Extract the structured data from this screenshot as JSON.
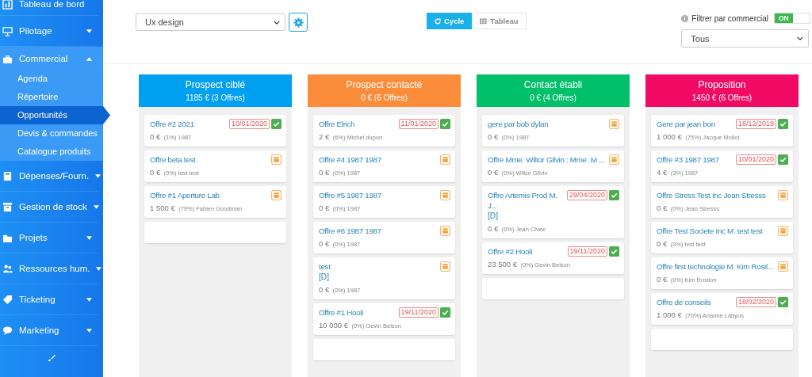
{
  "sidebar": {
    "items": [
      {
        "label": "Tableau de bord",
        "expanded": false,
        "has_caret": false
      },
      {
        "label": "Pilotage",
        "expanded": false,
        "has_caret": true
      },
      {
        "label": "Commercial",
        "expanded": true,
        "has_caret": true,
        "children": [
          {
            "label": "Agenda",
            "selected": false
          },
          {
            "label": "Répertoire",
            "selected": false
          },
          {
            "label": "Opportunités",
            "selected": true
          },
          {
            "label": "Devis & commandes",
            "selected": false
          },
          {
            "label": "Catalogue produits",
            "selected": false
          }
        ]
      },
      {
        "label": "Dépenses/Fourn.",
        "expanded": false,
        "has_caret": true
      },
      {
        "label": "Gestion de stock",
        "expanded": false,
        "has_caret": true
      },
      {
        "label": "Projets",
        "expanded": false,
        "has_caret": true
      },
      {
        "label": "Ressources hum.",
        "expanded": false,
        "has_caret": true
      },
      {
        "label": "Ticketing",
        "expanded": false,
        "has_caret": true
      },
      {
        "label": "Marketing",
        "expanded": false,
        "has_caret": true
      }
    ]
  },
  "toolbar": {
    "pipeline_select": "Ux design",
    "view_toggle": [
      {
        "label": "Cycle",
        "selected": true
      },
      {
        "label": "Tableau",
        "selected": false
      }
    ],
    "filter_label": "Filtrer par commercial",
    "filter_switch": {
      "label": "ON",
      "on": true
    },
    "commercial_select": "Tous"
  },
  "columns": [
    {
      "title": "Prospect ciblé",
      "summary": "1185 € (3 Offres)",
      "color": "#00a0f0",
      "cards": [
        {
          "title": "Offre #2 2021",
          "amount": "0 €",
          "detail": "(1%) 1987",
          "kind": "dated",
          "date": "10/01/2020"
        },
        {
          "title": "Offre beta test",
          "amount": "0 €",
          "detail": "(0%) test test",
          "kind": "pending"
        },
        {
          "title": "Offre #1 Aperture Lab",
          "amount": "1 500 €",
          "detail": "(79%) Fabien Goodman",
          "kind": "pending"
        }
      ]
    },
    {
      "title": "Prospect contacté",
      "summary": "0 € (6 Offres)",
      "color": "#fb8c3a",
      "cards": [
        {
          "title": "Offre Elrich",
          "amount": "2 €",
          "detail": "(6%) Michel dupon",
          "kind": "dated",
          "date": "11/01/2020"
        },
        {
          "title": "Offre #4 1987 1987",
          "amount": "0 €",
          "detail": "(0%) 1987",
          "kind": "pending"
        },
        {
          "title": "Offre #5 1987 1987",
          "amount": "0 €",
          "detail": "(0%) 1987",
          "kind": "pending"
        },
        {
          "title": "Offre #6 1987 1987",
          "amount": "0 €",
          "detail": "(0%) 1987",
          "kind": "pending"
        },
        {
          "title": "test",
          "tag": "[D]",
          "amount": "0 €",
          "detail": "(0%) 1987",
          "kind": "pending"
        },
        {
          "title": "Offre #1 Hooli",
          "amount": "10 000 €",
          "detail": "(0%) Gevin Belson",
          "kind": "dated",
          "date": "19/11/2020"
        }
      ]
    },
    {
      "title": "Contact établi",
      "summary": "0 € (4 Offres)",
      "color": "#00c06a",
      "cards": [
        {
          "title": "gere par bob dylan",
          "amount": "0 €",
          "detail": "(0%) 1987",
          "kind": "pending"
        },
        {
          "title": "Offre Mme. Wiltor Gilvin : Mme. ivi ...",
          "amount": "0 €",
          "detail": "(0%) Wiltor Gilvin",
          "kind": "pending"
        },
        {
          "title": "Offre Artemis Prod M. J...",
          "tag": "[D]",
          "amount": "0 €",
          "detail": "(0%) Jean Civee",
          "kind": "dated",
          "date": "29/04/2020"
        },
        {
          "title": "Offre #2 Hooli",
          "amount": "23 500 €",
          "detail": "(0%) Gevin Belson",
          "kind": "dated",
          "date": "19/11/2020"
        }
      ]
    },
    {
      "title": "Proposition",
      "summary": "1450 € (6 Offres)",
      "color": "#f00a64",
      "cards": [
        {
          "title": "Gere par jean bon",
          "amount": "1 000 €",
          "detail": "(75%) Jacque Mollot",
          "kind": "dated",
          "date": "18/12/2019"
        },
        {
          "title": "Offre #3 1987 1987",
          "amount": "4 €",
          "detail": "(3%) 1987",
          "kind": "dated",
          "date": "10/01/2020"
        },
        {
          "title": "Offre Stress Test Inc Jean Stresss",
          "amount": "0 €",
          "detail": "(0%) Jean Stresss",
          "kind": "pending"
        },
        {
          "title": "Offre Test Societe Inc M. test test",
          "amount": "0 €",
          "detail": "(0%) test test",
          "kind": "pending"
        },
        {
          "title": "Offre first technologie M. Kim Rosil...",
          "amount": "0 €",
          "detail": "(0%) Kim Rosilon",
          "kind": "pending"
        },
        {
          "title": "Offre de conseils",
          "amount": "1 000 €",
          "detail": "(70%) Arianne Labyus",
          "kind": "dated",
          "date": "18/02/2020"
        }
      ]
    }
  ]
}
